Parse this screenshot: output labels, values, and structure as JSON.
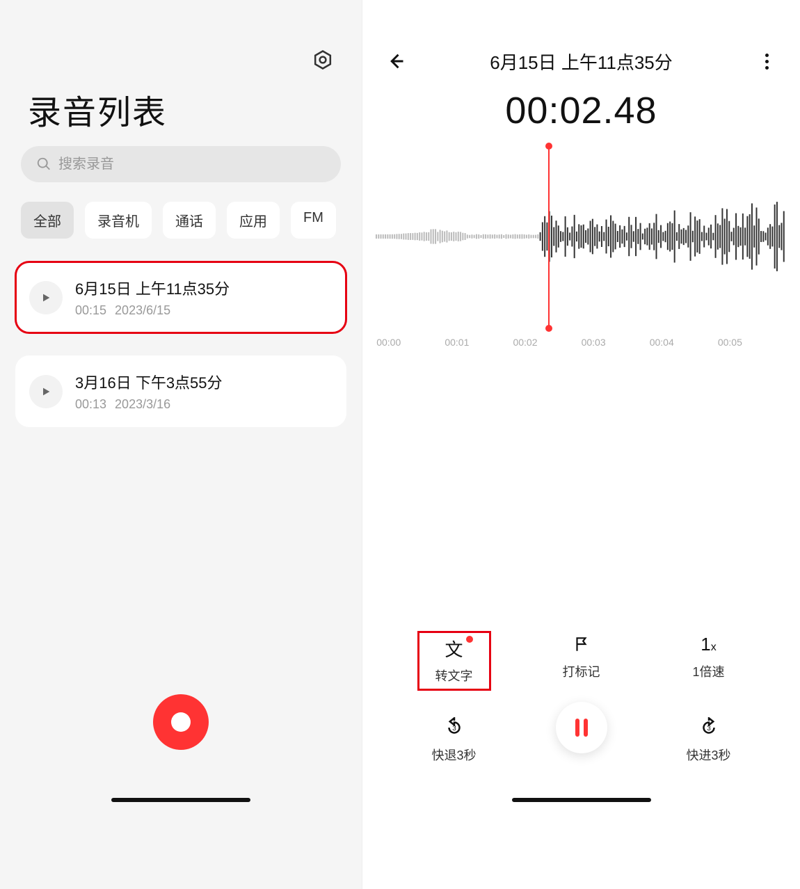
{
  "left": {
    "title": "录音列表",
    "search_placeholder": "搜索录音",
    "tabs": [
      "全部",
      "录音机",
      "通话",
      "应用",
      "FM"
    ],
    "active_tab": 0,
    "recordings": [
      {
        "title": "6月15日 上午11点35分",
        "duration": "00:15",
        "date": "2023/6/15",
        "highlight": true
      },
      {
        "title": "3月16日 下午3点55分",
        "duration": "00:13",
        "date": "2023/3/16",
        "highlight": false
      }
    ]
  },
  "right": {
    "title": "6月15日 上午11点35分",
    "timer": "00:02.48",
    "playhead_fraction": 0.395,
    "ticks": [
      "00:00",
      "00:01",
      "00:02",
      "00:03",
      "00:04",
      "00:05"
    ],
    "controls_top": [
      {
        "icon": "文",
        "label": "转文字",
        "dot": true,
        "highlight": true
      },
      {
        "icon": "flag",
        "label": "打标记",
        "dot": false,
        "highlight": false
      },
      {
        "icon": "1x",
        "label": "1倍速",
        "dot": false,
        "highlight": false
      }
    ],
    "controls_bottom": [
      {
        "icon": "back3",
        "label": "快退3秒"
      },
      {
        "icon": "pause",
        "label": ""
      },
      {
        "icon": "fwd3",
        "label": "快进3秒"
      }
    ]
  }
}
